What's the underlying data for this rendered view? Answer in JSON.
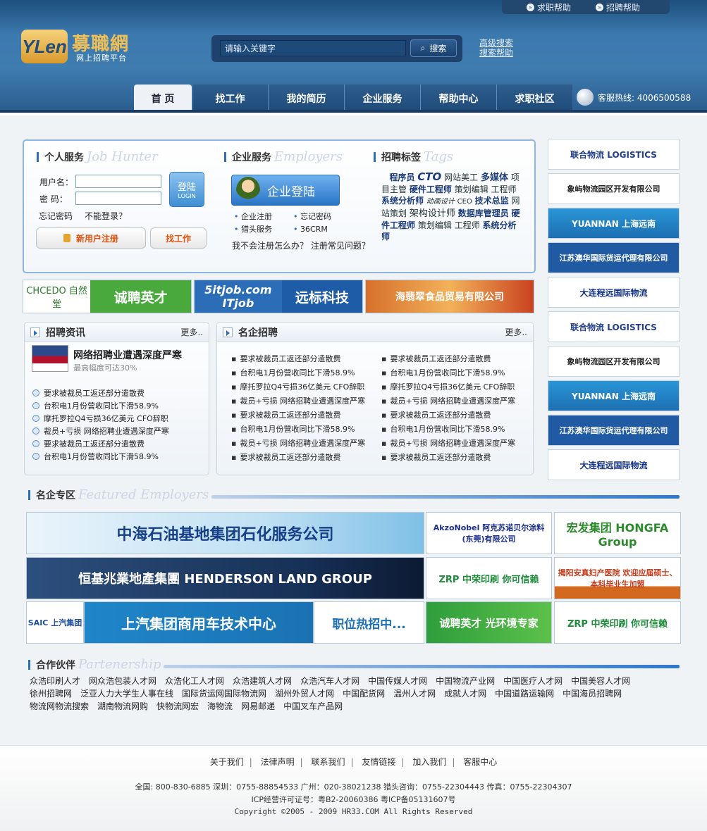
{
  "header": {
    "top_help": [
      "求职帮助",
      "招聘帮助"
    ],
    "logo_mark": "YLen",
    "logo_name": "募職網",
    "logo_sub": "网上招聘平台",
    "search_placeholder": "请输入关键字",
    "search_button": "搜索",
    "adv_links": [
      "高级搜索",
      "搜索帮助"
    ],
    "nav": [
      "首 页",
      "找工作",
      "我的简历",
      "企业服务",
      "帮助中心",
      "求职社区"
    ],
    "hotline": "客服热线: 4006500588"
  },
  "personal": {
    "title": "个人服务",
    "title_en": "Job Hunter",
    "username_label": "用户名：",
    "password_label": "密  码：",
    "login_btn": "登陆",
    "login_btn_en": "LOGIN",
    "forgot": "忘记密码",
    "cannot_login": "不能登录？",
    "register_btn": "新用户注册",
    "findjob_btn": "找工作"
  },
  "enterprise": {
    "title": "企业服务",
    "title_en": "Employers",
    "login_btn": "企业登陆",
    "links": [
      "企业注册",
      "忘记密码",
      "猎头服务",
      "36CRM"
    ],
    "help": "我不会注册怎么办？ 注册常见问题？"
  },
  "tags": {
    "title": "招聘标签",
    "title_en": "Tags",
    "items": [
      "程序员",
      "CTO",
      "网站美工",
      "多媒体",
      "项目主管",
      "硬件工程师",
      "策划编辑",
      "工程师",
      "系统分析师",
      "动画设计",
      "CEO",
      "技术总监",
      "网站策划",
      "架构设计师",
      "数据库管理员",
      "硬件工程师",
      "策划编辑",
      "工程师",
      "系统分析师"
    ]
  },
  "banners_mid": [
    "CHCEDO 自然堂",
    "诚聘英才",
    "5itjob.com ITjob",
    "远标科技",
    "海翡翠食品贸易有限公司"
  ],
  "sidebar_ads": [
    "联合物流 LOGISTICS",
    "象屿物流园区开发有限公司",
    "YUANNAN 上海远南",
    "江苏澳华国际货运代理有限公司",
    "大连程远国际物流",
    "联合物流 LOGISTICS",
    "象屿物流园区开发有限公司",
    "YUANNAN 上海远南",
    "江苏澳华国际货运代理有限公司",
    "大连程远国际物流"
  ],
  "news_panel": {
    "title": "招聘资讯",
    "more": "更多..",
    "feature_title": "网络招聘业遭遇深度严寒",
    "feature_sub": "最高幅度可达30%",
    "items": [
      "要求被裁员工返还部分遣散费",
      "台积电1月份营收同比下滑58.9%",
      "摩托罗拉Q4亏损36亿美元 CFO辞职",
      "裁员+亏损 网络招聘业遭遇深度严寒",
      "要求被裁员工返还部分遣散费",
      "台积电1月份营收同比下滑58.9%"
    ]
  },
  "famous_panel": {
    "title": "名企招聘",
    "more": "更多..",
    "col1": [
      "要求被裁员工返还部分遣散费",
      "台积电1月份营收同比下滑58.9%",
      "摩托罗拉Q4亏损36亿美元 CFO辞职",
      "裁员+亏损 网络招聘业遭遇深度严寒",
      "要求被裁员工返还部分遣散费",
      "台积电1月份营收同比下滑58.9%",
      "裁员+亏损 网络招聘业遭遇深度严寒",
      "要求被裁员工返还部分遣散费"
    ],
    "col2": [
      "要求被裁员工返还部分遣散费",
      "台积电1月份营收同比下滑58.9%",
      "摩托罗拉Q4亏损36亿美元 CFO辞职",
      "裁员+亏损 网络招聘业遭遇深度严寒",
      "要求被裁员工返还部分遣散费",
      "台积电1月份营收同比下滑58.9%",
      "裁员+亏损 网络招聘业遭遇深度严寒",
      "要求被裁员工返还部分遣散费"
    ]
  },
  "featured": {
    "title": "名企专区",
    "title_en": "Featured Employers",
    "ads": [
      "中海石油基地集团石化服务公司",
      "AkzoNobel 阿克苏诺贝尔涂料(东莞)有限公司",
      "宏发集团 HONGFA Group",
      "恒基兆業地產集團 HENDERSON LAND GROUP",
      "ZRP 中荣印刷 你可信赖",
      "揭阳安真妇产医院 欢迎应届硕士、本科毕业生加盟",
      "SAIC 上汽集团",
      "上汽集团商用车技术中心",
      "职位热招中...",
      "诚聘英才 光环境专家",
      "ZRP 中荣印刷 你可信赖"
    ]
  },
  "partners": {
    "title": "合作伙伴",
    "title_en": "Partenership",
    "items": [
      "众浩印刷人才",
      "网众浩包装人才网",
      "众浩化工人才网",
      "众浩建筑人才网",
      "众浩汽车人才网",
      "中国传媒人才网",
      "中国物流产业网",
      "中国医疗人才网",
      "中国美容人才网",
      "徐州招聘网",
      "泛亚人力大学生人事在线",
      "国际货运网国际物流网",
      "湖州外贸人才网",
      "中国配货网",
      "温州人才网",
      "成就人才网",
      "中国道路运输网",
      "中国海员招聘网",
      "物流网物流搜索",
      "湖南物流网购",
      "快物流网宏",
      "海物流",
      "网易邮递",
      "中国叉车产品网"
    ]
  },
  "footer": {
    "links": [
      "关于我们",
      "法律声明",
      "联系我们",
      "友情链接",
      "加入我们",
      "客服中心"
    ],
    "contact": "全国: 800-830-6885  深圳：0755-88854533  广州：020-38021238  猎头咨询：0755-22304443  传真：0755-22304307",
    "icp": "ICP经营许可证号：粤B2-20060386  粤ICP备05131607号",
    "copyright": "Copyright ©2005 - 2009 HR33.COM All Rights Reserved"
  }
}
